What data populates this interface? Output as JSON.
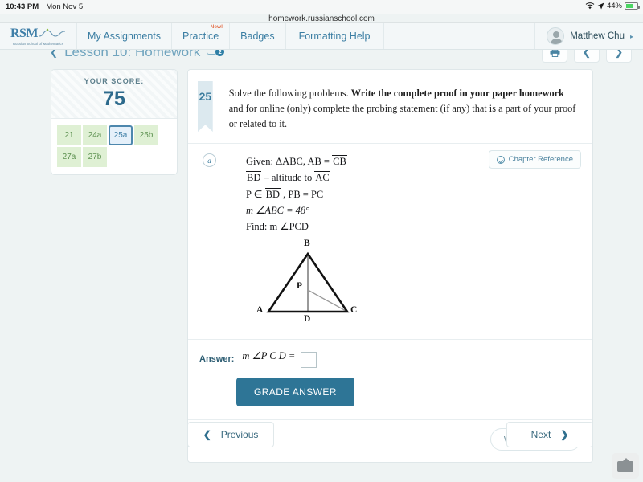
{
  "statusbar": {
    "time": "10:43 PM",
    "date": "Mon Nov 5",
    "battery_pct": "44%",
    "wifi_icon": "wifi-icon",
    "location_icon": "location-arrow-icon",
    "battery_icon": "battery-charging-icon"
  },
  "browser": {
    "url": "homework.russianschool.com"
  },
  "nav": {
    "logo_text": "RSM",
    "logo_tagline": "Russian School of Mathematics",
    "tabs": [
      {
        "label": "My Assignments",
        "badge": ""
      },
      {
        "label": "Practice",
        "badge": "New!"
      },
      {
        "label": "Badges",
        "badge": ""
      },
      {
        "label": "Formatting Help",
        "badge": ""
      }
    ],
    "user_name": "Matthew Chu",
    "user_caret": "▸"
  },
  "lesson": {
    "back_icon": "back-chevron-icon",
    "title": "Lesson 10: Homework",
    "comment_count": "2"
  },
  "toolbar": {
    "print_icon": "print-icon",
    "prev_icon": "chevron-left-icon",
    "next_icon": "chevron-right-icon"
  },
  "score": {
    "label": "YOUR SCORE:",
    "value": "75",
    "chips": [
      {
        "label": "21",
        "selected": false
      },
      {
        "label": "24a",
        "selected": false
      },
      {
        "label": "25a",
        "selected": true
      },
      {
        "label": "25b",
        "selected": false
      },
      {
        "label": "27a",
        "selected": false
      },
      {
        "label": "27b",
        "selected": false
      }
    ]
  },
  "problem": {
    "number": "25",
    "text_plain": "Solve the following problems. ",
    "text_bold": "Write the complete proof in your paper homework",
    "text_rest": " and for online (only) complete the probing statement (if any) that is a part of your proof or related to it.",
    "part_label": "a",
    "chapter_reference": "Chapter Reference",
    "given": {
      "line1_prefix": "Given: ΔABC, AB = ",
      "line1_seg": "CB",
      "line2_seg1": "BD",
      "line2_mid": " – altitude to ",
      "line2_seg2": "AC",
      "line3_prefix": "P ∈ ",
      "line3_seg": "BD",
      "line3_rest": " , PB = PC",
      "line4": "m ∠ABC = 48°",
      "line5": "Find: m ∠PCD"
    },
    "figure": {
      "vertices": [
        "A",
        "B",
        "C",
        "D",
        "P"
      ],
      "description": "isosceles triangle ABC with altitude BD and point P on BD joined to C"
    }
  },
  "answer": {
    "label": "Answer:",
    "expression": "m ∠P C D =",
    "input_value": "",
    "input_placeholder": "",
    "grade_button": "GRADE ANSWER"
  },
  "comment": {
    "button_label": "Write a comment"
  },
  "pagenav": {
    "previous": "Previous",
    "next": "Next",
    "prev_icon": "chevron-left-icon",
    "next_icon": "chevron-right-icon"
  },
  "keyboard_button": {
    "icon": "keyboard-icon"
  },
  "colors": {
    "accent": "#2e7596",
    "page_bg": "#eef3f3",
    "chip_green": "#dff0d4",
    "chip_selected": "#e5f0fa",
    "new_badge": "#e3704a"
  }
}
